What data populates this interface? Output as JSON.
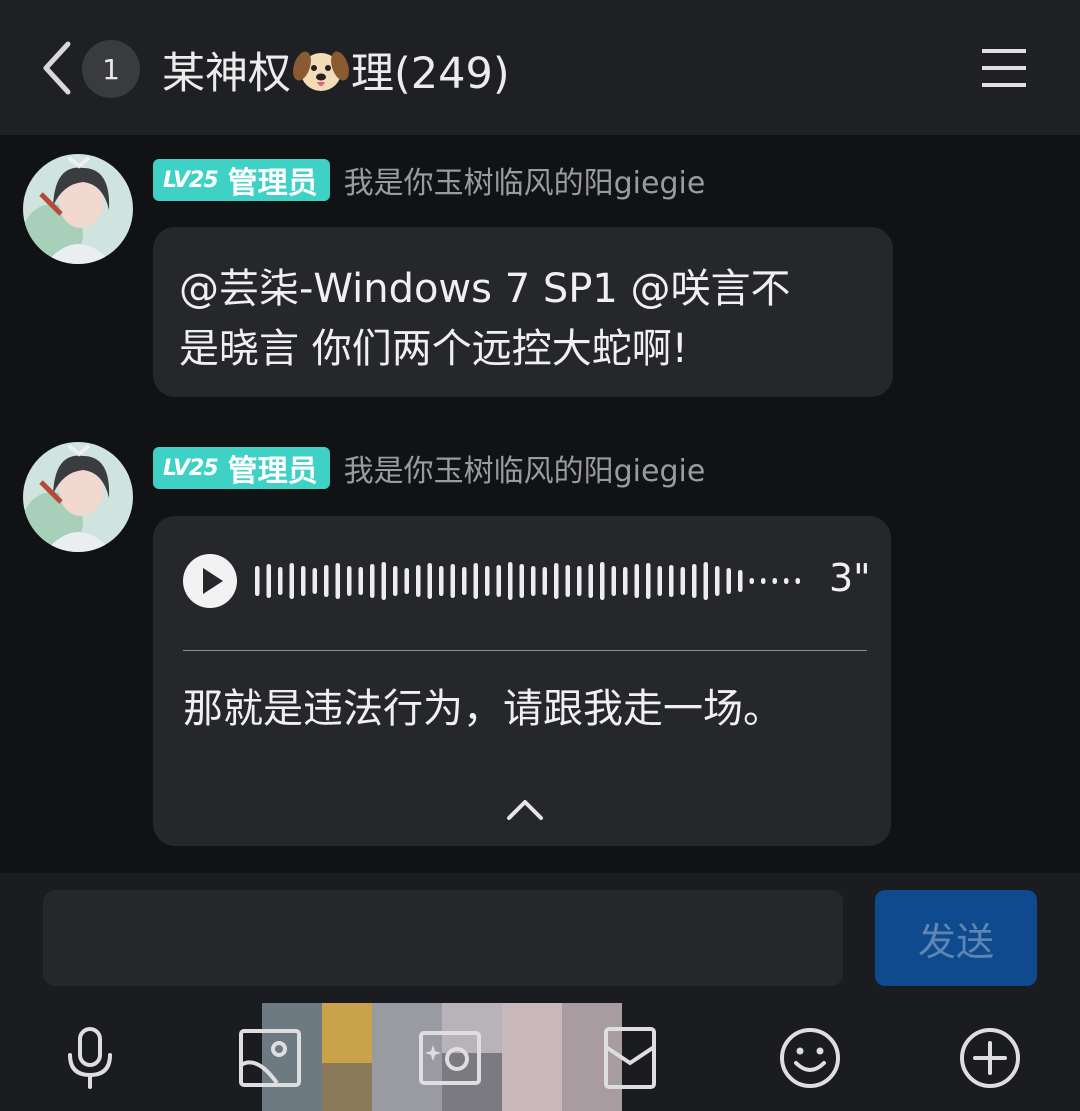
{
  "header": {
    "unread_count": "1",
    "title_prefix": "某神权",
    "title_emoji": "dog-face-icon",
    "title_suffix": "理(249)"
  },
  "messages": [
    {
      "level": "LV25",
      "role": "管理员",
      "nickname": "我是你玉树临风的阳giegie",
      "text_line1": "@芸柒-Windows 7 SP1 @咲言不",
      "text_line2": "是晓言 你们两个远控大蛇啊!"
    },
    {
      "level": "LV25",
      "role": "管理员",
      "nickname": "我是你玉树临风的阳giegie",
      "voice_duration": "3\"",
      "transcript": "那就是违法行为，请跟我走一场。"
    }
  ],
  "composer": {
    "input_value": "",
    "send_label": "发送"
  },
  "toolbar": {
    "icons": [
      "microphone-icon",
      "image-icon",
      "camera-icon",
      "red-packet-icon",
      "emoji-icon",
      "plus-icon"
    ]
  },
  "colors": {
    "header_bg": "#1f2023",
    "chat_bg": "#111214",
    "bubble_bg": "#26272b",
    "level_badge": "#3fd1c6",
    "send_button": "#0f4a8e",
    "send_text": "#5e86b4"
  }
}
